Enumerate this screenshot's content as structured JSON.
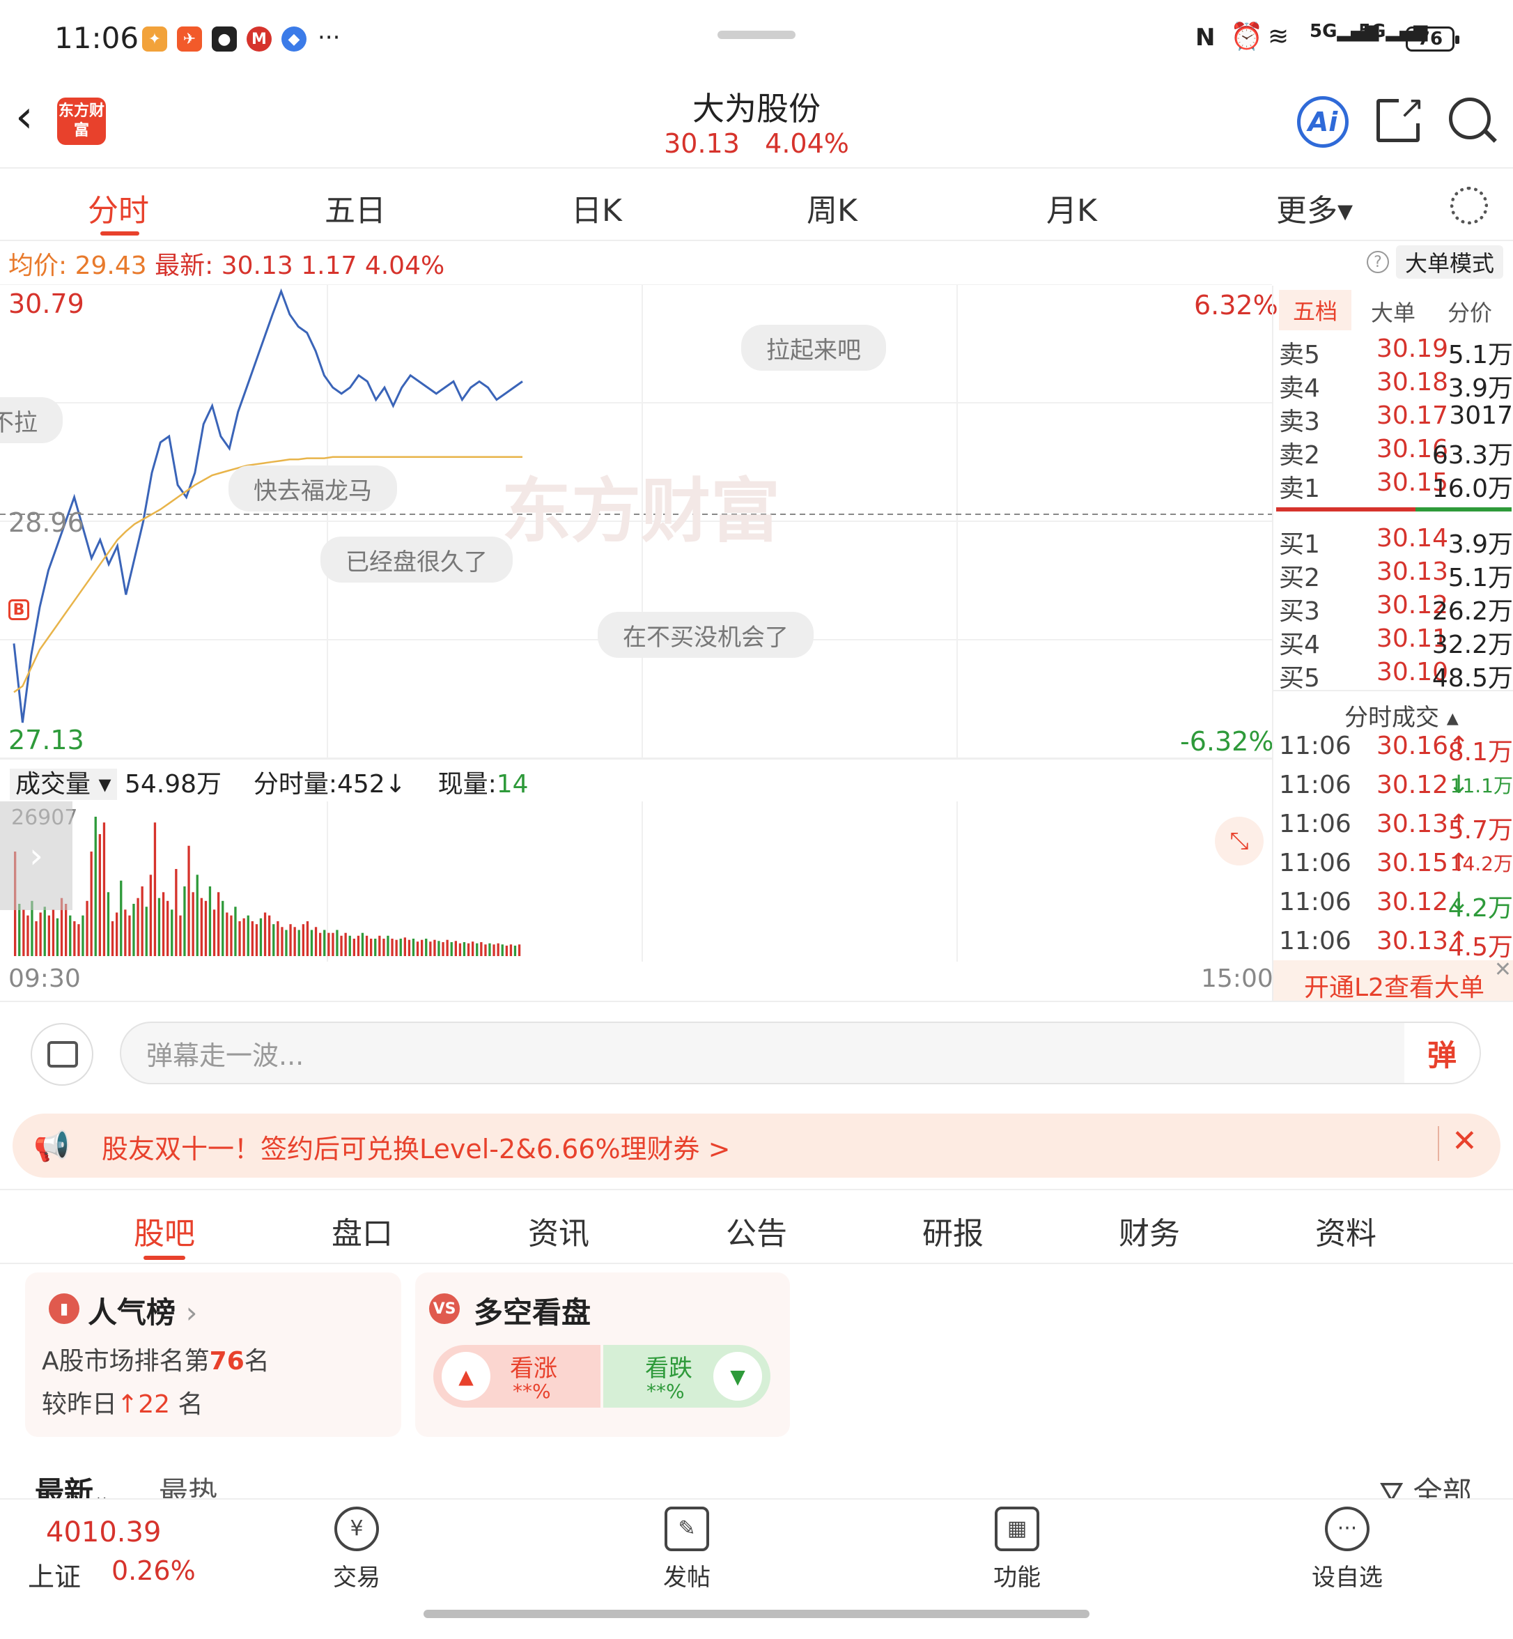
{
  "status_bar": {
    "time": "11:06",
    "battery": "76",
    "signal": "5G"
  },
  "header": {
    "title": "大为股份",
    "price": "30.13",
    "change_pct": "4.04%",
    "logo_text": "东方财富",
    "ai_label": "Ai"
  },
  "ktabs": [
    "分时",
    "五日",
    "日K",
    "周K",
    "月K",
    "更多▾"
  ],
  "info": {
    "avg_label": "均价:",
    "avg_value": "29.43",
    "latest_label": "最新:",
    "latest_value": "30.13",
    "change": "1.17",
    "change_pct": "4.04%",
    "mode_button": "大单模式",
    "help": "?"
  },
  "chart_data": {
    "type": "line",
    "title": "",
    "y_high": "30.79",
    "y_low": "27.13",
    "y_prev_close": "28.96",
    "pct_high": "6.32%",
    "pct_low": "-6.32%",
    "ylim": [
      27.13,
      30.79
    ],
    "x_start": "09:30",
    "x_end": "15:00",
    "watermark": "东方财富",
    "buy_marker": "B",
    "series": [
      {
        "values": [
          27.9,
          27.25,
          27.8,
          28.2,
          28.5,
          28.7,
          28.9,
          29.1,
          28.85,
          28.6,
          28.75,
          28.55,
          28.7,
          28.3,
          28.6,
          28.9,
          29.3,
          29.55,
          29.6,
          29.2,
          29.1,
          29.3,
          29.7,
          29.85,
          29.6,
          29.5,
          29.8,
          30.0,
          30.2,
          30.4,
          30.6,
          30.79,
          30.6,
          30.5,
          30.45,
          30.3,
          30.1,
          30.0,
          29.95,
          30.0,
          30.1,
          30.05,
          29.9,
          30.0,
          29.85,
          30.0,
          30.1,
          30.05,
          30.0,
          29.95,
          30.0,
          30.05,
          29.9,
          30.0,
          30.05,
          30.0,
          29.9,
          29.95,
          30.0,
          30.05
        ]
      },
      {
        "values": [
          27.5,
          27.55,
          27.7,
          27.85,
          27.95,
          28.05,
          28.15,
          28.25,
          28.35,
          28.45,
          28.55,
          28.65,
          28.75,
          28.82,
          28.88,
          28.92,
          28.96,
          29.0,
          29.05,
          29.1,
          29.15,
          29.2,
          29.24,
          29.28,
          29.3,
          29.32,
          29.34,
          29.36,
          29.37,
          29.38,
          29.39,
          29.4,
          29.41,
          29.41,
          29.42,
          29.42,
          29.42,
          29.43,
          29.43,
          29.43,
          29.43,
          29.43,
          29.43,
          29.43,
          29.43,
          29.43,
          29.43,
          29.43,
          29.43,
          29.43,
          29.43,
          29.43,
          29.43,
          29.43,
          29.43,
          29.43,
          29.43,
          29.43,
          29.43,
          29.43
        ]
      }
    ],
    "volume": {
      "max_label": "26907",
      "bars": [
        180,
        90,
        80,
        70,
        95,
        60,
        75,
        85,
        70,
        80,
        65,
        100,
        90,
        70,
        60,
        55,
        70,
        95,
        180,
        240,
        210,
        230,
        110,
        60,
        75,
        130,
        80,
        70,
        90,
        100,
        120,
        85,
        140,
        230,
        100,
        110,
        95,
        80,
        150,
        70,
        120,
        190,
        110,
        140,
        100,
        95,
        120,
        80,
        110,
        95,
        75,
        70,
        85,
        60,
        65,
        70,
        60,
        55,
        65,
        75,
        70,
        55,
        60,
        50,
        45,
        55,
        50,
        45,
        55,
        60,
        45,
        50,
        40,
        45,
        40,
        40,
        45,
        35,
        40,
        35,
        30,
        35,
        40,
        35,
        30,
        30,
        35,
        30,
        35,
        30,
        28,
        30,
        32,
        28,
        30,
        25,
        28,
        30,
        25,
        28,
        26,
        24,
        28,
        24,
        26,
        22,
        24,
        22,
        25,
        22,
        24,
        20,
        22,
        20,
        22,
        20,
        18,
        20,
        18,
        20
      ]
    }
  },
  "danmaku": [
    {
      "text": "拉起来吧"
    },
    {
      "text": "不拉"
    },
    {
      "text": "快去福龙马"
    },
    {
      "text": "已经盘很久了"
    },
    {
      "text": "在不买没机会了"
    }
  ],
  "orderbook": {
    "tabs": [
      "五档",
      "大单",
      "分价"
    ],
    "asks": [
      {
        "label": "卖5",
        "price": "30.19",
        "vol": "5.1万"
      },
      {
        "label": "卖4",
        "price": "30.18",
        "vol": "3.9万"
      },
      {
        "label": "卖3",
        "price": "30.17",
        "vol": "3017"
      },
      {
        "label": "卖2",
        "price": "30.16",
        "vol": "63.3万"
      },
      {
        "label": "卖1",
        "price": "30.15",
        "vol": "16.0万"
      }
    ],
    "bids": [
      {
        "label": "买1",
        "price": "30.14",
        "vol": "3.9万"
      },
      {
        "label": "买2",
        "price": "30.13",
        "vol": "5.1万"
      },
      {
        "label": "买3",
        "price": "30.12",
        "vol": "26.2万"
      },
      {
        "label": "买4",
        "price": "30.11",
        "vol": "32.2万"
      },
      {
        "label": "买5",
        "price": "30.10",
        "vol": "48.5万"
      }
    ],
    "ticks_title": "分时成交",
    "ticks": [
      {
        "time": "11:06",
        "price": "30.16",
        "arrow": "↑",
        "vol": "8.1万",
        "dir": "up"
      },
      {
        "time": "11:06",
        "price": "30.12",
        "arrow": "↓",
        "vol": "11.1万",
        "dir": "down"
      },
      {
        "time": "11:06",
        "price": "30.13",
        "arrow": "↑",
        "vol": "5.7万",
        "dir": "up"
      },
      {
        "time": "11:06",
        "price": "30.15",
        "arrow": "↑",
        "vol": "14.2万",
        "dir": "up"
      },
      {
        "time": "11:06",
        "price": "30.12",
        "arrow": "↓",
        "vol": "4.2万",
        "dir": "down"
      },
      {
        "time": "11:06",
        "price": "30.13",
        "arrow": "↑",
        "vol": "4.5万",
        "dir": "up"
      }
    ],
    "l2_link": "开通L2查看大单"
  },
  "volume_header": {
    "label": "成交量",
    "total": "54.98万",
    "minute_label": "分时量:452↓",
    "now_label": "现量:",
    "now_value": "14"
  },
  "danmu_input": {
    "placeholder": "弹幕走一波...",
    "send": "弹"
  },
  "banner": {
    "text": "股友双十一！签约后可兑换Level-2&6.66%理财券 >"
  },
  "section_tabs": [
    "股吧",
    "盘口",
    "资讯",
    "公告",
    "研报",
    "财务",
    "资料"
  ],
  "popularity_card": {
    "title": "人气榜",
    "rank_prefix": "A股市场排名第",
    "rank": "76",
    "rank_suffix": "名",
    "change_prefix": "较昨日",
    "change": "22",
    "change_suffix": "名"
  },
  "bull_bear_card": {
    "title": "多空看盘",
    "bull_label": "看涨",
    "bull_pct": "**%",
    "bear_label": "看跌",
    "bear_pct": "**%"
  },
  "sort_row": {
    "latest": "最新",
    "hot": "最热",
    "filter": "全部"
  },
  "bottom_nav": {
    "index_value": "4010.39",
    "index_name": "上证",
    "index_pct": "0.26%",
    "items": [
      {
        "label": "交易",
        "glyph": "¥"
      },
      {
        "label": "发帖",
        "glyph": "✎"
      },
      {
        "label": "功能",
        "glyph": "▦"
      },
      {
        "label": "设自选",
        "glyph": "···"
      }
    ]
  }
}
